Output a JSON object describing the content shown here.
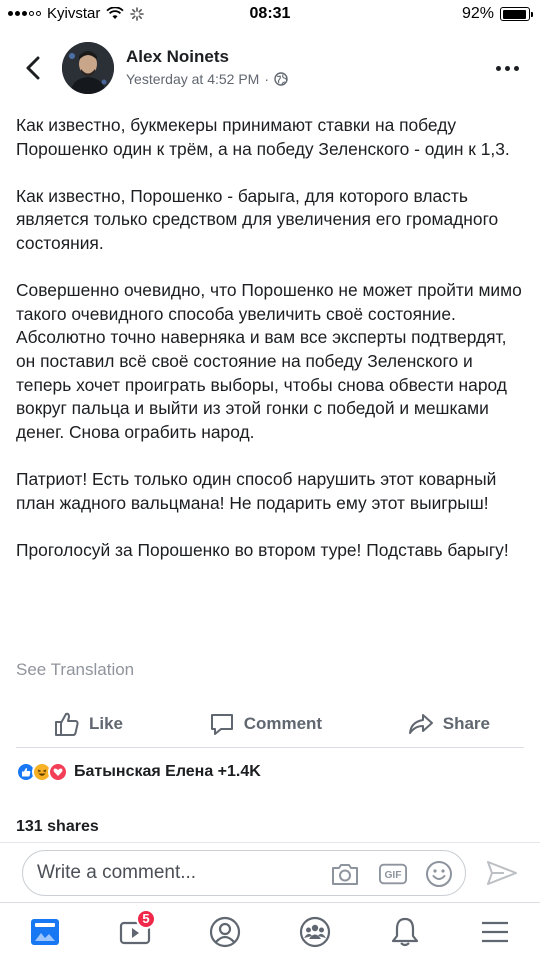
{
  "status_bar": {
    "carrier": "Kyivstar",
    "time": "08:31",
    "battery_percent": "92%",
    "battery_level": 0.92
  },
  "post": {
    "author": "Alex Noinets",
    "timestamp": "Yesterday at 4:52 PM",
    "separator": "·",
    "privacy_icon": "globe-icon",
    "paragraphs": [
      "Как известно, букмекеры принимают ставки на победу Порошенко один к трём, а на победу Зеленского - один к 1,3.",
      "Как известно, Порошенко - барыга, для которого власть является только средством для увеличения его громадного состояния.",
      "Совершенно очевидно, что Порошенко не может пройти мимо такого очевидного способа увеличить своё состояние. Абсолютно точно наверняка и вам все эксперты подтвердят, он поставил всё своё состояние на победу Зеленского и теперь хочет проиграть выборы, чтобы снова обвести народ вокруг пальца и выйти из этой гонки с победой и мешками денег. Снова ограбить народ.",
      "Патриот! Есть только один способ нарушить этот коварный план жадного вальцмана! Не подарить ему этот выигрыш!",
      "Проголосуй за Порошенко во втором туре! Подставь барыгу!"
    ],
    "see_translation": "See Translation"
  },
  "actions": {
    "like": "Like",
    "comment": "Comment",
    "share": "Share"
  },
  "reactions": {
    "icons": [
      "like-icon",
      "haha-icon",
      "love-icon"
    ],
    "summary": "Батынская Елена +1.4K"
  },
  "shares": "131 shares",
  "composer": {
    "placeholder": "Write a comment...",
    "icons": [
      "camera-icon",
      "gif-icon",
      "emoji-icon"
    ]
  },
  "bottom_nav": {
    "items": [
      "news-feed-icon",
      "watch-icon",
      "profile-icon",
      "groups-icon",
      "notifications-icon",
      "menu-icon"
    ],
    "watch_badge": "5"
  },
  "colors": {
    "link_blue": "#1877f2",
    "secondary_text": "#606770",
    "badge_red": "#f02849"
  }
}
